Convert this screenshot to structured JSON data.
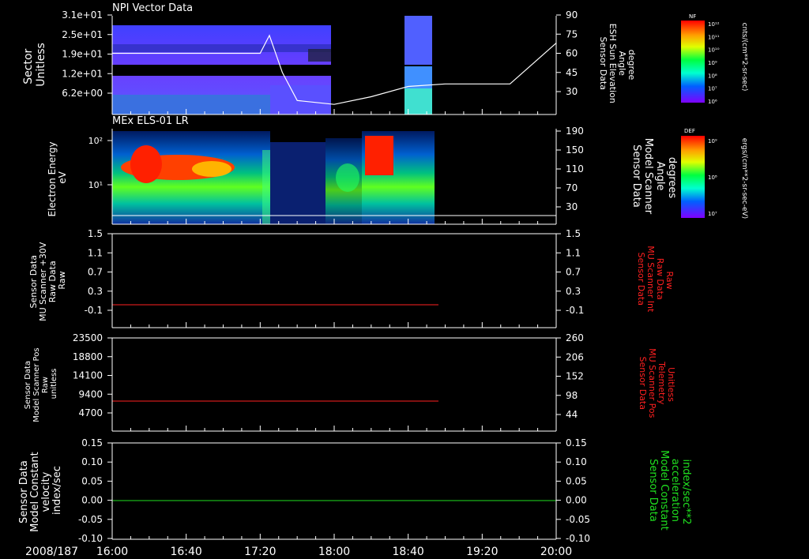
{
  "date_label": "2008/187",
  "time_ticks": [
    "16:00",
    "16:40",
    "17:20",
    "18:00",
    "18:40",
    "19:20",
    "20:00"
  ],
  "colors": {
    "white": "#ffffff",
    "red": "#ff2020",
    "green": "#20e020"
  },
  "panel1": {
    "title": "NPI Vector Data",
    "left_label": [
      "Sector",
      "Unitless"
    ],
    "left_ticks": [
      "3.1e+01",
      "2.5e+01",
      "1.9e+01",
      "1.2e+01",
      "6.2e+00"
    ],
    "right_label": [
      "Sensor Data",
      "ESH Sun Elevation",
      "Angle",
      "degree"
    ],
    "right_ticks": [
      "90",
      "75",
      "60",
      "45",
      "30"
    ],
    "colorbar_label": "NF",
    "colorbar_ticks": [
      "10¹²",
      "10¹¹",
      "10¹⁰",
      "10⁹",
      "10⁸",
      "10⁷",
      "10⁶"
    ],
    "units": "cnts/(cm**2-sr-sec)"
  },
  "panel2": {
    "title": "MEx ELS-01 LR",
    "left_label": [
      "Electron Energy",
      "eV"
    ],
    "left_ticks": [
      "10²",
      "10¹"
    ],
    "right_label": [
      "Sensor Data",
      "Model Scanner",
      "Angle",
      "degrees"
    ],
    "right_ticks": [
      "190",
      "150",
      "110",
      "70",
      "30"
    ],
    "colorbar_label": "DEF",
    "colorbar_ticks": [
      "10⁹",
      "10⁸",
      "10⁷"
    ],
    "units": "ergs/(cm**2-sr-sec-eV)"
  },
  "panel3": {
    "left_label": [
      "Sensor Data",
      "MU Scanner +30V",
      "Raw Data",
      "Raw"
    ],
    "left_ticks": [
      "1.5",
      "1.1",
      "0.7",
      "0.3",
      "-0.1"
    ],
    "right_label": [
      "Sensor Data",
      "MU Scanner Int",
      "Raw Data",
      "Raw"
    ],
    "right_ticks": [
      "1.5",
      "1.1",
      "0.7",
      "0.3",
      "-0.1"
    ]
  },
  "panel4": {
    "left_label": [
      "Sensor Data",
      "Model Scanner Pos",
      "Raw",
      "unitless"
    ],
    "left_ticks": [
      "23500",
      "18800",
      "14100",
      "9400",
      "4700"
    ],
    "right_label": [
      "Sensor Data",
      "MU Scanner Pos",
      "Telemetry",
      "Unitless"
    ],
    "right_ticks": [
      "260",
      "206",
      "152",
      "98",
      "44"
    ]
  },
  "panel5": {
    "left_label": [
      "Sensor Data",
      "Model Constant",
      "velocity",
      "index/sec"
    ],
    "left_ticks": [
      "0.15",
      "0.10",
      "0.05",
      "0.00",
      "-0.05",
      "-0.10"
    ],
    "right_label": [
      "Sensor Data",
      "Model Constant",
      "acceleration",
      "index/sec**2"
    ],
    "right_ticks": [
      "0.15",
      "0.10",
      "0.05",
      "0.00",
      "-0.05",
      "-0.10"
    ]
  },
  "chart_data": [
    {
      "type": "heatmap",
      "title": "NPI Vector Data",
      "x_range": [
        "16:00",
        "20:00"
      ],
      "ylabel": "Sector Unitless",
      "data_intervals": [
        [
          "16:00",
          "17:55"
        ],
        [
          "18:30",
          "18:43"
        ]
      ],
      "overlay_line": {
        "name": "ESH Sun Elevation Angle",
        "x": [
          "16:00",
          "17:00",
          "17:20",
          "17:25",
          "17:32",
          "17:40",
          "18:00",
          "18:20",
          "18:40",
          "19:00",
          "19:20",
          "19:35",
          "20:00"
        ],
        "y": [
          60,
          60,
          60,
          74,
          45,
          23,
          20,
          26,
          34,
          36,
          36,
          36,
          68
        ]
      }
    },
    {
      "type": "heatmap",
      "title": "MEx ELS-01 LR",
      "x_range": [
        "16:00",
        "20:00"
      ],
      "ylabel": "Electron Energy eV",
      "y_scale": "log",
      "data_interval": [
        "16:00",
        "18:50"
      ],
      "overlay_line": {
        "name": "Model Scanner Angle",
        "value": 15
      }
    },
    {
      "type": "line",
      "series": [
        {
          "name": "MU Scanner +30V Raw",
          "x": [
            "16:00",
            "18:50"
          ],
          "y": [
            -0.1,
            -0.1
          ]
        }
      ],
      "ylim": [
        -0.1,
        1.5
      ]
    },
    {
      "type": "line",
      "series": [
        {
          "name": "Model Scanner Pos Raw",
          "x": [
            "16:00",
            "18:50"
          ],
          "y": [
            8200,
            8200
          ]
        }
      ],
      "ylim": [
        2000,
        23500
      ]
    },
    {
      "type": "line",
      "series": [
        {
          "name": "Model Constant velocity",
          "x": [
            "16:00",
            "20:00"
          ],
          "y": [
            0,
            0
          ]
        }
      ],
      "ylim": [
        -0.1,
        0.15
      ]
    }
  ]
}
